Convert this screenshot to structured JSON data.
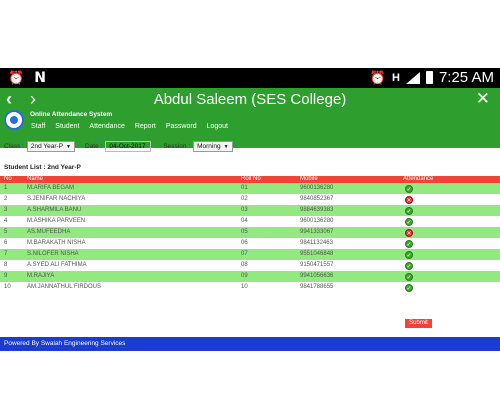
{
  "status_bar": {
    "time": "7:25 AM",
    "network": "H"
  },
  "app_bar": {
    "title": "Abdul Saleem (SES College)",
    "system_name": "Online Attendance System",
    "menu": [
      "Staff",
      "Student",
      "Attendance",
      "Report",
      "Password",
      "Logout"
    ]
  },
  "filters": {
    "class_label": "Class :",
    "class_value": "2nd Year-P",
    "date_label": "Date :",
    "date_value": "04-Oct-2017",
    "session_label": "Session :",
    "session_value": "Morning"
  },
  "list_title": "Student List : 2nd Year-P",
  "table": {
    "headers": [
      "No",
      "Name",
      "Roll No",
      "Mobile",
      "Attendance"
    ],
    "rows": [
      {
        "no": "1",
        "name": "M.ARIFA BEGAM",
        "roll": "01",
        "mobile": "9600136280",
        "status": "present"
      },
      {
        "no": "2",
        "name": "S.JENIFAR NACHIYA",
        "roll": "02",
        "mobile": "9840852367",
        "status": "absent"
      },
      {
        "no": "3",
        "name": "A.SHARMILA BANU",
        "roll": "03",
        "mobile": "9884639383",
        "status": "present"
      },
      {
        "no": "4",
        "name": "M.ASHIKA PARVEEN",
        "roll": "04",
        "mobile": "9600136280",
        "status": "present"
      },
      {
        "no": "5",
        "name": "AS.MUFEEDHA",
        "roll": "05",
        "mobile": "9941333067",
        "status": "absent"
      },
      {
        "no": "6",
        "name": "M.BARAKATH NISHA",
        "roll": "06",
        "mobile": "9841132463",
        "status": "present"
      },
      {
        "no": "7",
        "name": "S.NILOFER NISHA",
        "roll": "07",
        "mobile": "9551046848",
        "status": "present"
      },
      {
        "no": "8",
        "name": "A.SYED ALI FATHIMA",
        "roll": "08",
        "mobile": "9150471557",
        "status": "present"
      },
      {
        "no": "9",
        "name": "M.RAJIYA",
        "roll": "09",
        "mobile": "9941056636",
        "status": "present"
      },
      {
        "no": "10",
        "name": "AM.JANNATHUL FIRDOUS",
        "roll": "10",
        "mobile": "9841788655",
        "status": "present"
      }
    ]
  },
  "submit_label": "Submit",
  "footer_text": "Powered By Swalah Engineering Services",
  "colors": {
    "app_bar": "#2e9e2e",
    "header_row": "#f44336",
    "row_green": "#92e97f",
    "footer": "#1a3bd4"
  }
}
